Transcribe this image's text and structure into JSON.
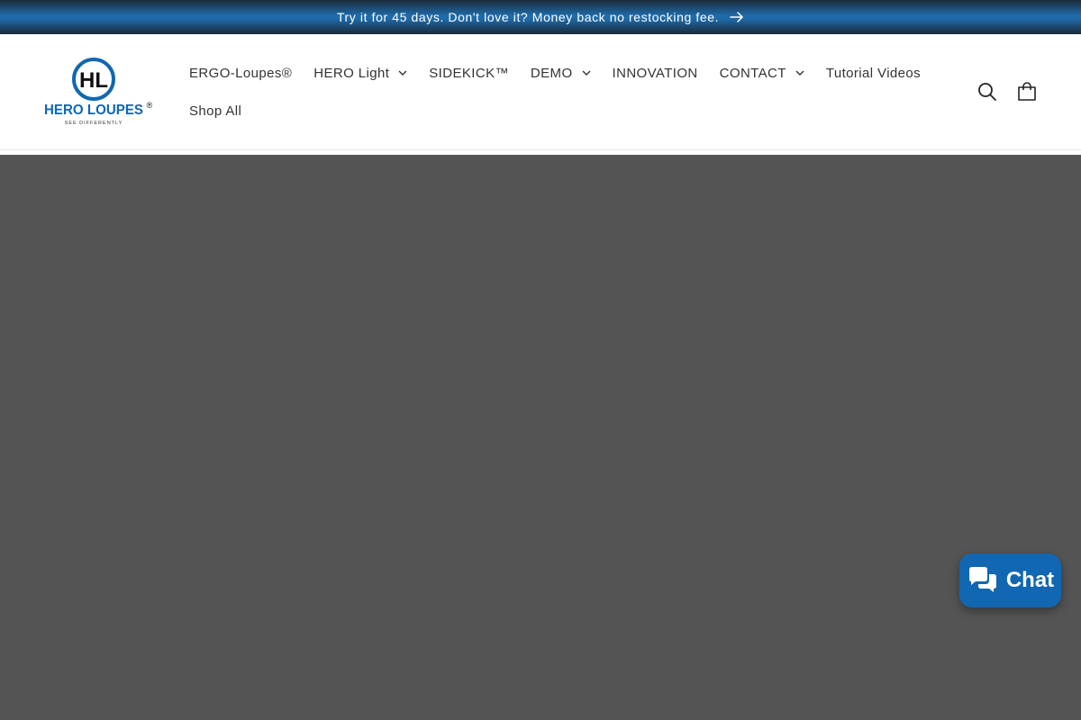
{
  "announcement": {
    "text": "Try it for 45 days. Don't love it? Money back no restocking fee.",
    "icon": "arrow-right-icon"
  },
  "logo": {
    "monogram": "HL",
    "name": "HERO LOUPES",
    "registered": "®",
    "tagline": "SEE DIFFERENTLY"
  },
  "nav": {
    "items": [
      {
        "label": "ERGO-Loupes®",
        "has_dropdown": false
      },
      {
        "label": "HERO Light",
        "has_dropdown": true
      },
      {
        "label": "SIDEKICK™",
        "has_dropdown": false
      },
      {
        "label": "DEMO",
        "has_dropdown": true
      },
      {
        "label": "INNOVATION",
        "has_dropdown": false
      },
      {
        "label": "CONTACT",
        "has_dropdown": true
      },
      {
        "label": "Tutorial Videos",
        "has_dropdown": false
      },
      {
        "label": "Shop All",
        "has_dropdown": false
      }
    ]
  },
  "header_icons": {
    "search": "search-icon",
    "cart": "cart-icon"
  },
  "chat": {
    "label": "Chat",
    "icon": "chat-bubbles-icon"
  },
  "colors": {
    "brand_blue": "#1167b1",
    "hero_background": "#545454",
    "text": "#333333"
  }
}
